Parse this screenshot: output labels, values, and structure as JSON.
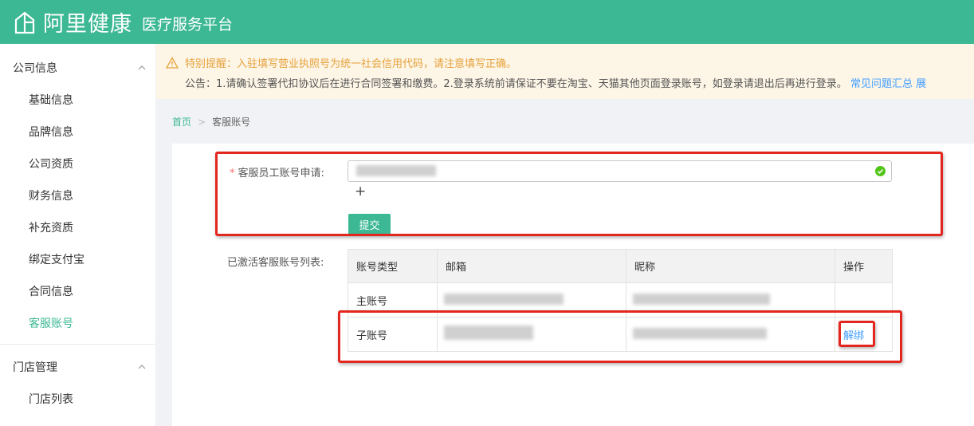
{
  "header": {
    "brand": "阿里健康",
    "subtitle": "医疗服务平台"
  },
  "sidebar": {
    "groups": [
      {
        "title": "公司信息",
        "items": [
          "基础信息",
          "品牌信息",
          "公司资质",
          "财务信息",
          "补充资质",
          "绑定支付宝",
          "合同信息",
          "客服账号"
        ]
      },
      {
        "title": "门店管理",
        "items": [
          "门店列表"
        ]
      }
    ],
    "active_item": "客服账号"
  },
  "notice": {
    "warning": "特别提醒：入驻填写营业执照号为统一社会信用代码，请注意填写正确。",
    "announcement": "公告：1.请确认签署代扣协议后在进行合同签署和缴费。2.登录系统前请保证不要在淘宝、天猫其他页面登录账号，如登录请退出后再进行登录。",
    "link": "常见问题汇总",
    "link_cut": "展"
  },
  "breadcrumb": {
    "home": "首页",
    "sep": ">",
    "current": "客服账号"
  },
  "form": {
    "account_label": "客服员工账号申请:",
    "required_mark": "*",
    "add_symbol": "+",
    "submit_label": "提交",
    "list_label": "已激活客服账号列表:"
  },
  "table": {
    "headers": [
      "账号类型",
      "邮箱",
      "昵称",
      "操作"
    ],
    "rows": [
      {
        "type": "主账号",
        "action": ""
      },
      {
        "type": "子账号",
        "action": "解绑"
      }
    ]
  },
  "colors": {
    "brand": "#3db894",
    "highlight": "#e3261e",
    "link": "#409eff",
    "warning": "#e6a23c"
  }
}
